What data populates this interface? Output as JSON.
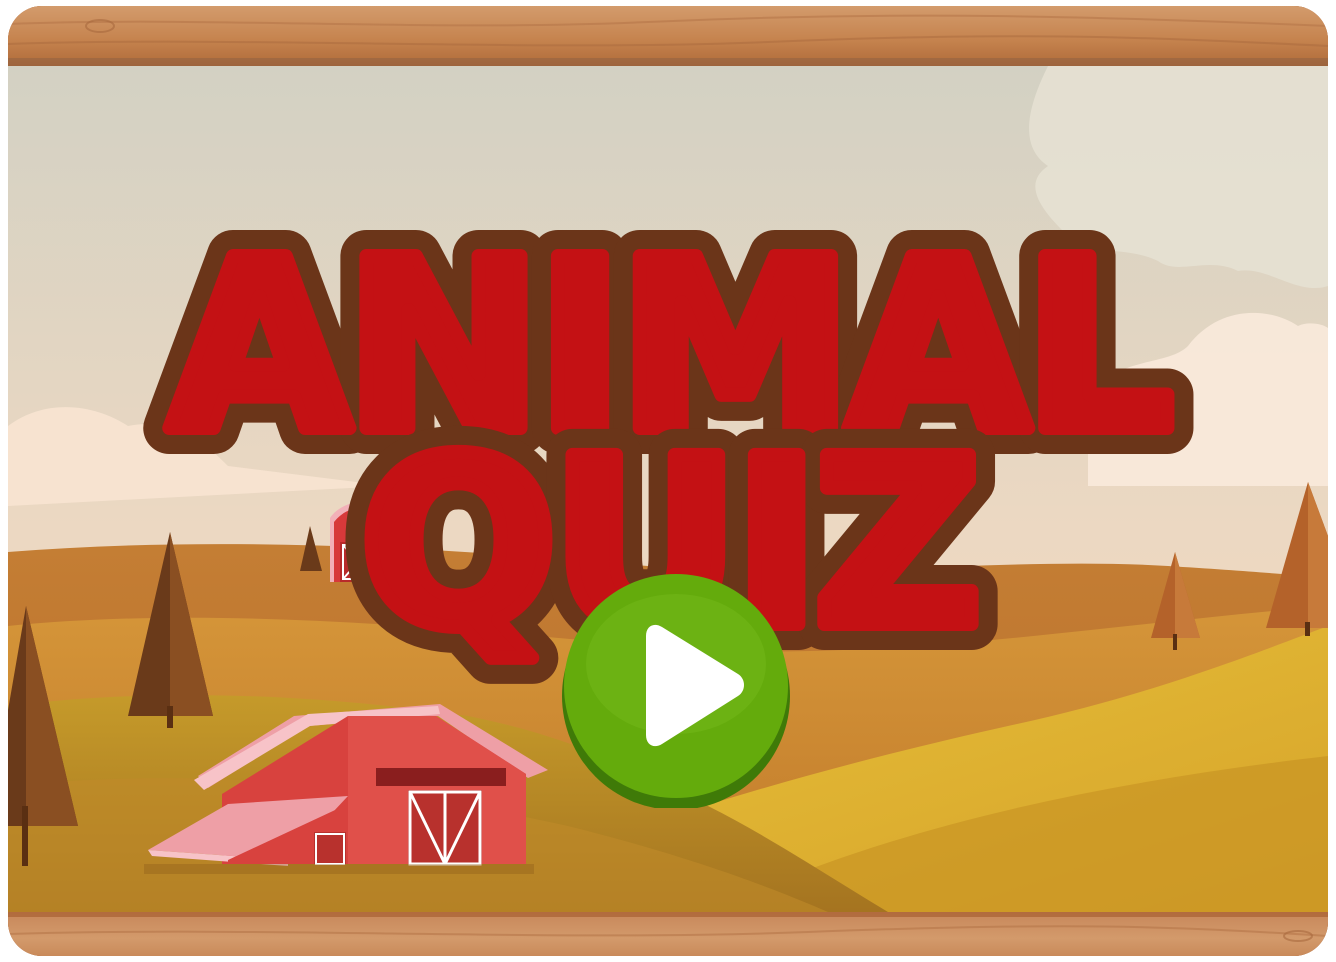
{
  "game": {
    "title_line1": "ANIMAL",
    "title_line2": "QUIZ"
  },
  "icons": {
    "play": "play-icon"
  },
  "colors": {
    "title_fill": "#c41114",
    "title_stroke": "#6b3519",
    "play_button": "#64ab0c",
    "play_button_shadow": "#3f7a08",
    "sky_top": "#d6d4c6",
    "sky_bottom": "#f7dcc4",
    "wood": "#c98a5a"
  }
}
